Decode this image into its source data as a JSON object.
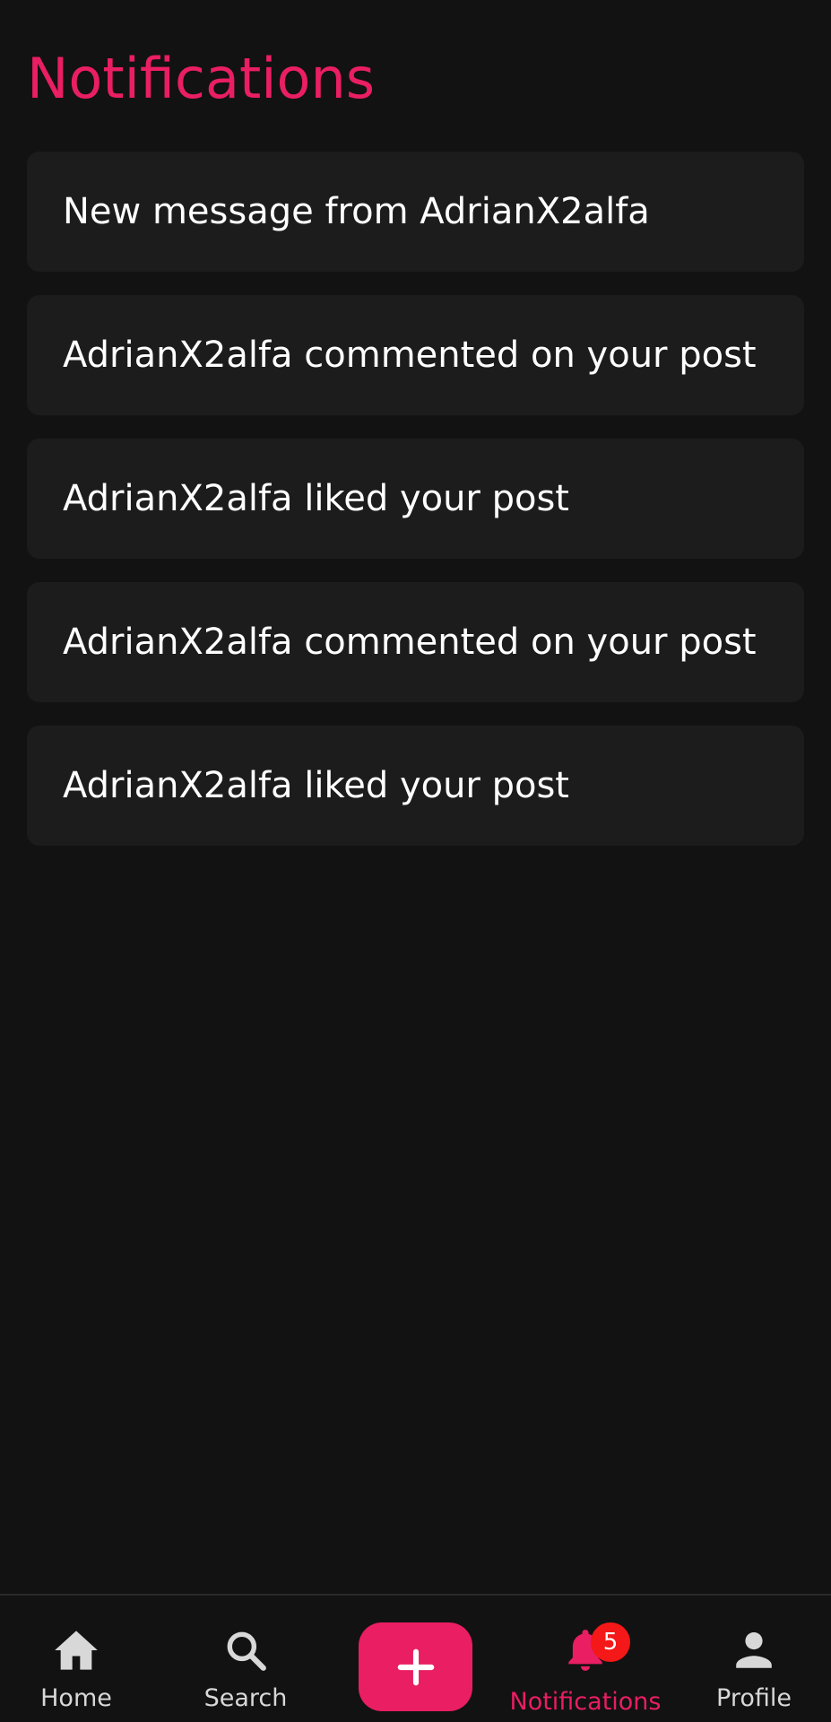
{
  "header": {
    "title": "Notifications"
  },
  "notifications": [
    {
      "text": "New message from AdrianX2alfa"
    },
    {
      "text": "AdrianX2alfa commented on your post"
    },
    {
      "text": "AdrianX2alfa liked your post"
    },
    {
      "text": "AdrianX2alfa commented on your post"
    },
    {
      "text": "AdrianX2alfa liked your post"
    }
  ],
  "bottom_nav": {
    "items": [
      {
        "label": "Home",
        "icon": "home-icon"
      },
      {
        "label": "Search",
        "icon": "search-icon"
      },
      {
        "label": "",
        "icon": "plus-icon"
      },
      {
        "label": "Notifications",
        "icon": "bell-icon",
        "badge": "5",
        "active": true
      },
      {
        "label": "Profile",
        "icon": "person-icon"
      }
    ]
  },
  "colors": {
    "accent": "#e91e63",
    "background": "#121212",
    "card": "#1c1c1c",
    "badge": "#f41818"
  }
}
